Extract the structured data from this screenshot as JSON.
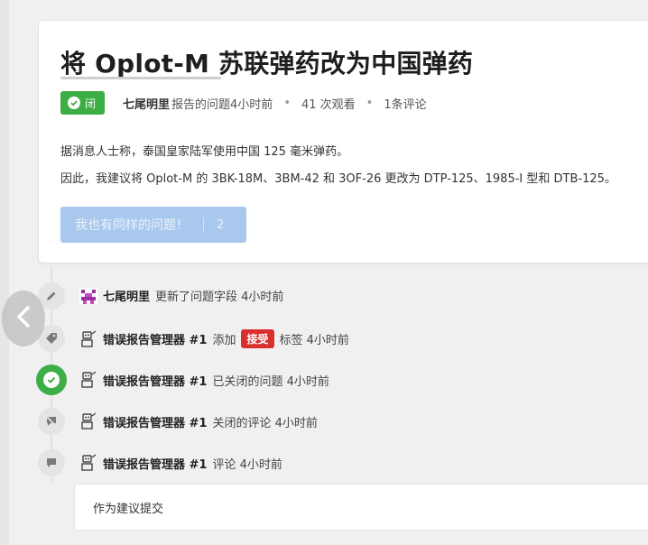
{
  "issue": {
    "title": "将 Oplot-M 苏联弹药改为中国弹药",
    "status_label": "闭",
    "author": "七尾明里",
    "reported_text": "报告的问题4小时前",
    "views": "41 次观看",
    "comments": "1条评论",
    "body": [
      "据消息人士称，泰国皇家陆军使用中国 125 毫米弹药。",
      "因此，我建议将 Oplot-M 的 3BK-18M、3BM-42 和 3OF-26 更改为 DTP-125、1985-I 型和 DTB-125。"
    ],
    "same_issue_label": "我也有同样的问题！",
    "same_issue_count": "2"
  },
  "timeline": [
    {
      "icon": "pencil-icon",
      "who": "七尾明里",
      "text": "更新了问题字段 4小时前"
    },
    {
      "icon": "tag-icon",
      "who": "错误报告管理器 #1",
      "text_before": "添加",
      "tag": "接受",
      "text_after": "标签 4小时前"
    },
    {
      "icon": "check-circle-icon",
      "who": "错误报告管理器 #1",
      "text": "已关闭的问题 4小时前"
    },
    {
      "icon": "comment-off-icon",
      "who": "错误报告管理器 #1",
      "text": "关闭的评论 4小时前"
    },
    {
      "icon": "comment-icon",
      "who": "错误报告管理器 #1",
      "text": "评论 4小时前"
    }
  ],
  "comment": {
    "text": "作为建议提交"
  },
  "colors": {
    "closed_badge": "#3cae45",
    "accepted_tag": "#d9302f",
    "same_issue_button": "#a8c8ee"
  }
}
